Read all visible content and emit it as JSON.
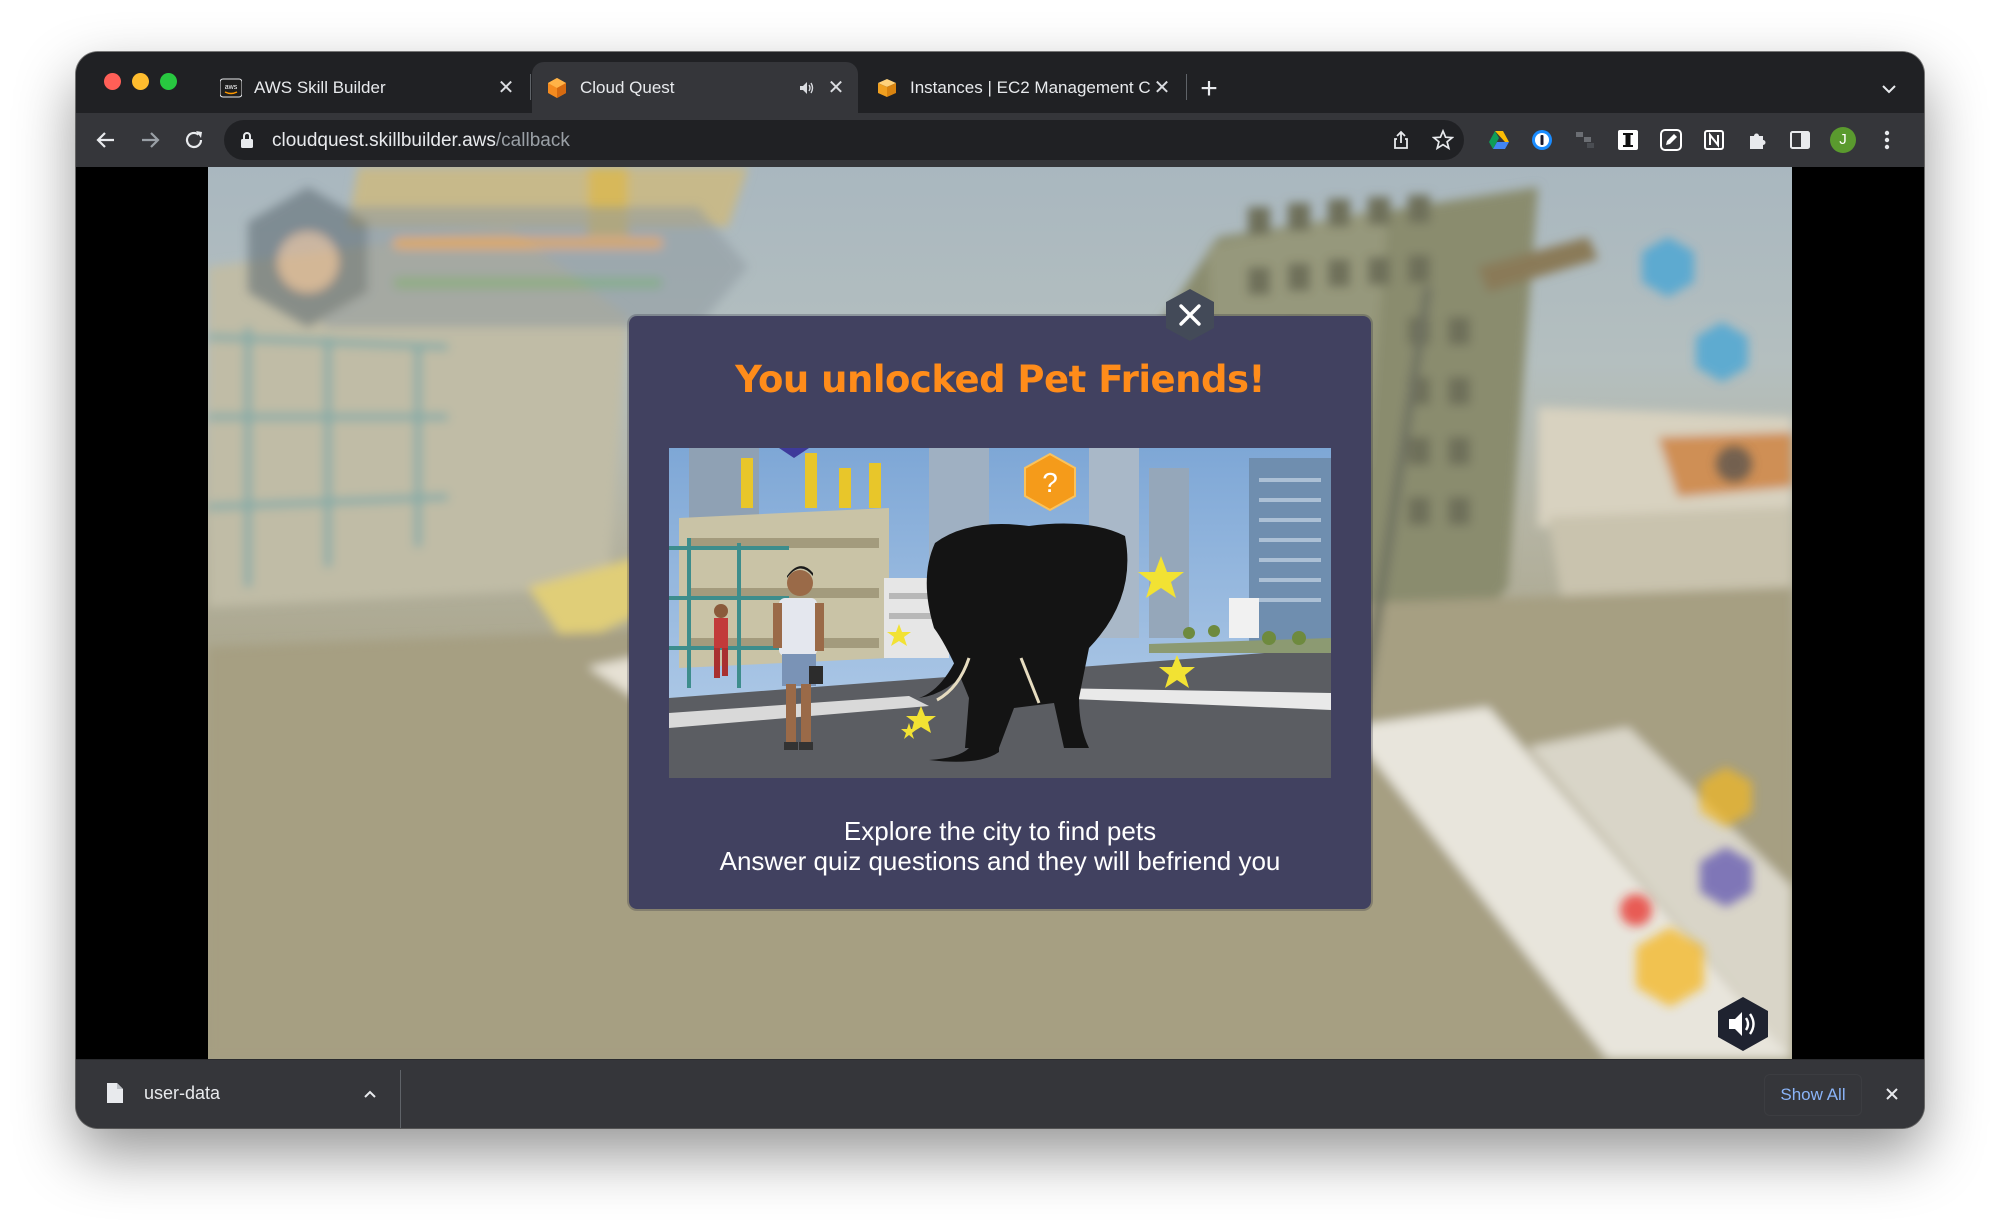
{
  "browser": {
    "tabs": [
      {
        "title": "AWS Skill Builder",
        "icon": "aws-logo-icon",
        "active": false
      },
      {
        "title": "Cloud Quest",
        "icon": "cloud-quest-cube-icon",
        "active": true,
        "muted_indicator": "speaker-icon"
      },
      {
        "title": "Instances | EC2 Management C",
        "icon": "aws-box-icon",
        "active": false
      }
    ],
    "new_tab_label": "+",
    "url": {
      "domain": "cloudquest.skillbuilder.aws",
      "path": "/callback"
    },
    "profile_initial": "J",
    "accent_colors": {
      "close": "#ff5f57",
      "minimize": "#febc2e",
      "maximize": "#28c840"
    }
  },
  "game": {
    "modal": {
      "title": "You unlocked Pet Friends!",
      "question_mark": "?",
      "line1": "Explore the city to find pets",
      "line2": "Answer quiz questions and they will befriend you",
      "title_color": "#ff8c1a",
      "background_color": "#414160"
    }
  },
  "download_bar": {
    "file_name": "user-data",
    "show_all_label": "Show All"
  }
}
